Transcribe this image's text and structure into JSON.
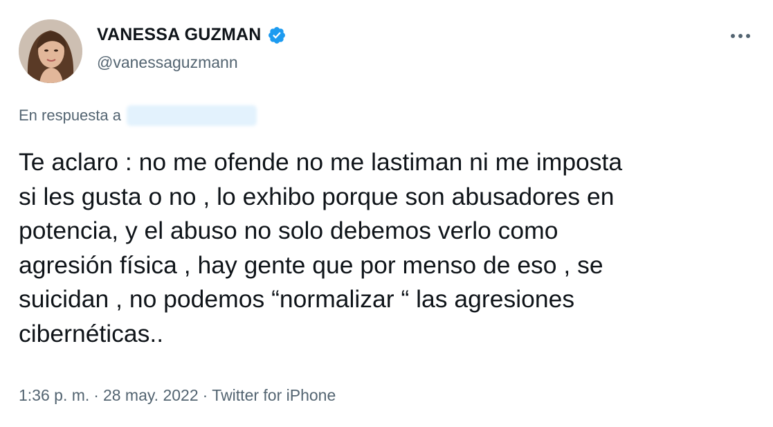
{
  "author": {
    "display_name": "VANESSA GUZMAN",
    "handle": "@vanessaguzmann",
    "verified": true,
    "avatar_icon": "profile-photo",
    "verified_icon": "verified-badge-icon",
    "verified_color": "#1d9bf0"
  },
  "menu": {
    "icon": "more-horizontal-icon"
  },
  "reply": {
    "label": "En respuesta a"
  },
  "tweet": {
    "text": "Te aclaro : no me ofende no me lastiman ni me imposta\nsi les gusta o no , lo exhibo porque  son abusadores en\npotencia, y el abuso no solo debemos verlo como\nagresión física , hay gente que por menso de eso , se\nsuicidan , no podemos “normalizar “ las agresiones\ncibernéticas.."
  },
  "meta": {
    "time": "1:36 p. m.",
    "separator": "·",
    "date": "28 may. 2022",
    "source": "Twitter for iPhone"
  },
  "colors": {
    "text_primary": "#0f1419",
    "text_secondary": "#536471",
    "accent": "#1d9bf0"
  }
}
